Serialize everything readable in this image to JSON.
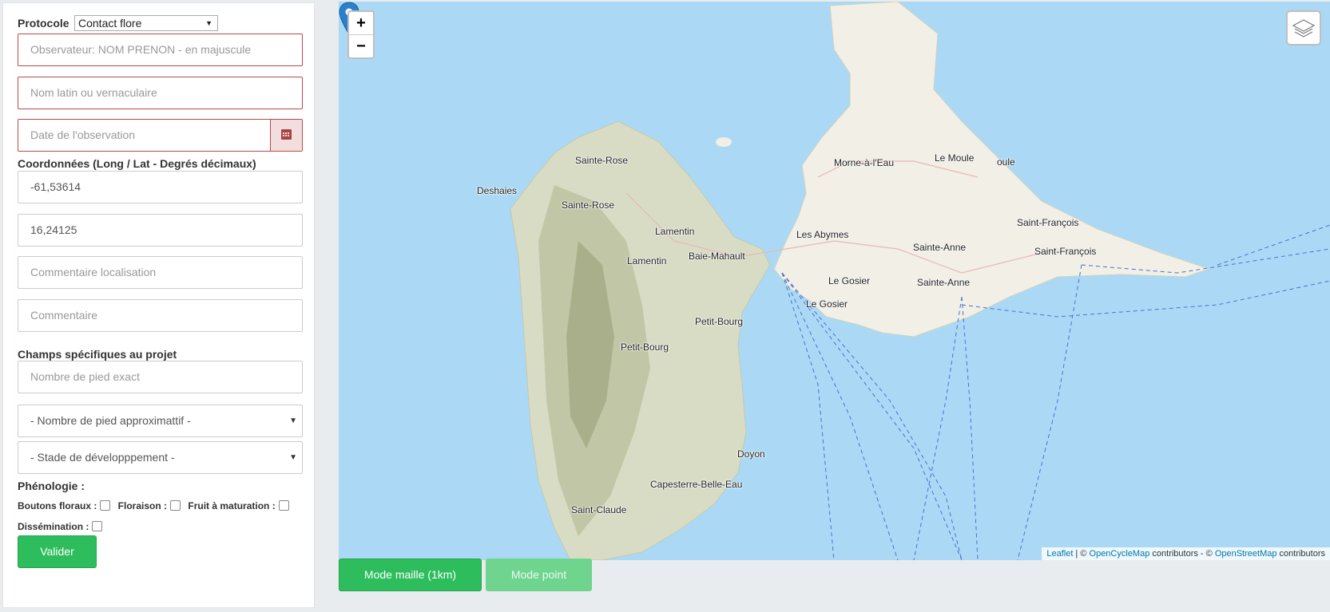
{
  "form": {
    "protocol_label": "Protocole",
    "protocol_value": "Contact flore",
    "observer_placeholder": "Observateur: NOM PRENON - en majuscule",
    "taxon_placeholder": "Nom latin ou vernaculaire",
    "date_placeholder": "Date de l'observation",
    "coords_label": "Coordonnées (Long / Lat - Degrés décimaux)",
    "longitude": "-61,53614",
    "latitude": "16,24125",
    "loc_comment_placeholder": "Commentaire localisation",
    "comment_placeholder": "Commentaire",
    "specific_fields_label": "Champs spécifiques au projet",
    "exact_count_placeholder": "Nombre de pied exact",
    "approx_count_value": "- Nombre de pied approximattif -",
    "stage_value": "- Stade de développpement -",
    "phenology_label": "Phénologie :",
    "phenology": {
      "buds": "Boutons floraux :",
      "flowering": "Floraison :",
      "fruit": "Fruit à maturation :",
      "dissemination": "Dissémination :"
    },
    "submit_label": "Valider"
  },
  "map": {
    "zoom_in": "+",
    "zoom_out": "−",
    "places": [
      {
        "name": "Sainte-Rose",
        "id": "sainte-rose-1"
      },
      {
        "name": "Deshaies",
        "id": "deshaies"
      },
      {
        "name": "Sainte-Rose",
        "id": "sainte-rose-2"
      },
      {
        "name": "Lamentin",
        "id": "lamentin-1"
      },
      {
        "name": "Lamentin",
        "id": "lamentin-2"
      },
      {
        "name": "Baie-Mahault",
        "id": "baie-mahault"
      },
      {
        "name": "Les Abymes",
        "id": "les-abymes"
      },
      {
        "name": "Morne-à-l'Eau",
        "id": "morne-a-leau"
      },
      {
        "name": "Le Moule",
        "id": "le-moule"
      },
      {
        "name": "oule",
        "id": "oule"
      },
      {
        "name": "Saint-François",
        "id": "saint-francois-1"
      },
      {
        "name": "Saint-François",
        "id": "saint-francois-2"
      },
      {
        "name": "Sainte-Anne",
        "id": "sainte-anne-1"
      },
      {
        "name": "Sainte-Anne",
        "id": "sainte-anne-2"
      },
      {
        "name": "Le Gosier",
        "id": "le-gosier-1"
      },
      {
        "name": "Le Gosier",
        "id": "le-gosier-2"
      },
      {
        "name": "Petit-Bourg",
        "id": "petit-bourg-1"
      },
      {
        "name": "Petit-Bourg",
        "id": "petit-bourg-2"
      },
      {
        "name": "Doyon",
        "id": "doyon"
      },
      {
        "name": "Capesterre-Belle-Eau",
        "id": "capesterre"
      },
      {
        "name": "Saint-Claude",
        "id": "saint-claude"
      }
    ],
    "attribution": {
      "leaflet": "Leaflet",
      "sep1": " | © ",
      "opencyclemap": "OpenCycleMap",
      "mid": " contributors - © ",
      "osm": "OpenStreetMap",
      "end": " contributors"
    }
  },
  "buttons": {
    "mode_grid": "Mode maille (1km)",
    "mode_point": "Mode point"
  },
  "colors": {
    "accent_green": "#2ebd5c",
    "error_red": "#b94a48",
    "sea": "#abd9f5",
    "land": "#f1efe6"
  }
}
